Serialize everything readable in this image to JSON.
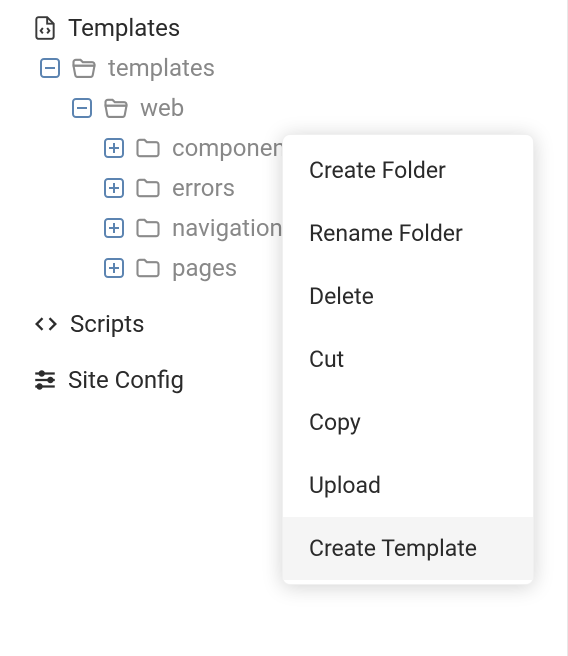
{
  "sections": {
    "templates_title": "Templates",
    "root_folder": "templates",
    "web_folder": "web",
    "children": [
      "components",
      "errors",
      "navigation",
      "pages"
    ],
    "scripts_title": "Scripts",
    "siteconfig_title": "Site Config"
  },
  "context_menu": {
    "items": [
      "Create Folder",
      "Rename Folder",
      "Delete",
      "Cut",
      "Copy",
      "Upload",
      "Create Template"
    ],
    "highlighted_index": 6
  }
}
